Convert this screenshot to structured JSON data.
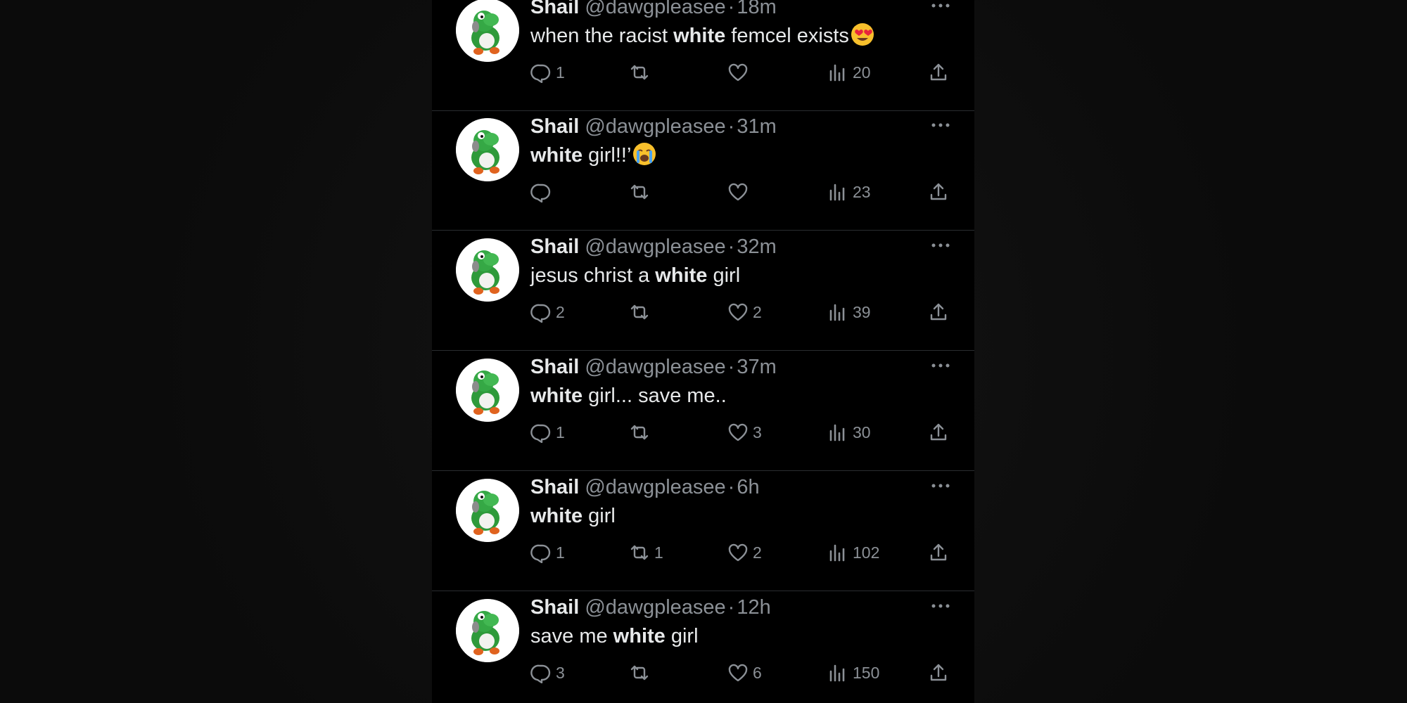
{
  "tweets": [
    {
      "name": "Shail",
      "handle": "@dawgpleasee",
      "sep": "·",
      "time": "18m",
      "text_before": "when the racist ",
      "text_bold": "white",
      "text_after": " femcel exists",
      "emoji": "heart-eyes",
      "replies": "1",
      "retweets": "",
      "likes": "",
      "views": "20"
    },
    {
      "name": "Shail",
      "handle": "@dawgpleasee",
      "sep": "·",
      "time": "31m",
      "text_before": "",
      "text_bold": "white",
      "text_after": " girl!!’",
      "emoji": "loudly-crying",
      "replies": "",
      "retweets": "",
      "likes": "",
      "views": "23"
    },
    {
      "name": "Shail",
      "handle": "@dawgpleasee",
      "sep": "·",
      "time": "32m",
      "text_before": "jesus christ a ",
      "text_bold": "white",
      "text_after": " girl",
      "emoji": "",
      "replies": "2",
      "retweets": "",
      "likes": "2",
      "views": "39"
    },
    {
      "name": "Shail",
      "handle": "@dawgpleasee",
      "sep": "·",
      "time": "37m",
      "text_before": "",
      "text_bold": "white",
      "text_after": " girl... save me..",
      "emoji": "",
      "replies": "1",
      "retweets": "",
      "likes": "3",
      "views": "30"
    },
    {
      "name": "Shail",
      "handle": "@dawgpleasee",
      "sep": "·",
      "time": "6h",
      "text_before": "",
      "text_bold": "white",
      "text_after": " girl",
      "emoji": "",
      "replies": "1",
      "retweets": "1",
      "likes": "2",
      "views": "102"
    },
    {
      "name": "Shail",
      "handle": "@dawgpleasee",
      "sep": "·",
      "time": "12h",
      "text_before": "save me ",
      "text_bold": "white",
      "text_after": " girl",
      "emoji": "",
      "replies": "3",
      "retweets": "",
      "likes": "6",
      "views": "150"
    }
  ],
  "icons": {
    "avatar": "yoshi-avatar-icon",
    "more": "more-horizontal-icon",
    "reply": "reply-icon",
    "retweet": "retweet-icon",
    "like": "heart-icon",
    "views": "views-chart-icon",
    "share": "share-icon"
  },
  "colors": {
    "background": "#000000",
    "text": "#e7e9ea",
    "secondary": "#8b9096",
    "divider": "#2a2d30"
  }
}
